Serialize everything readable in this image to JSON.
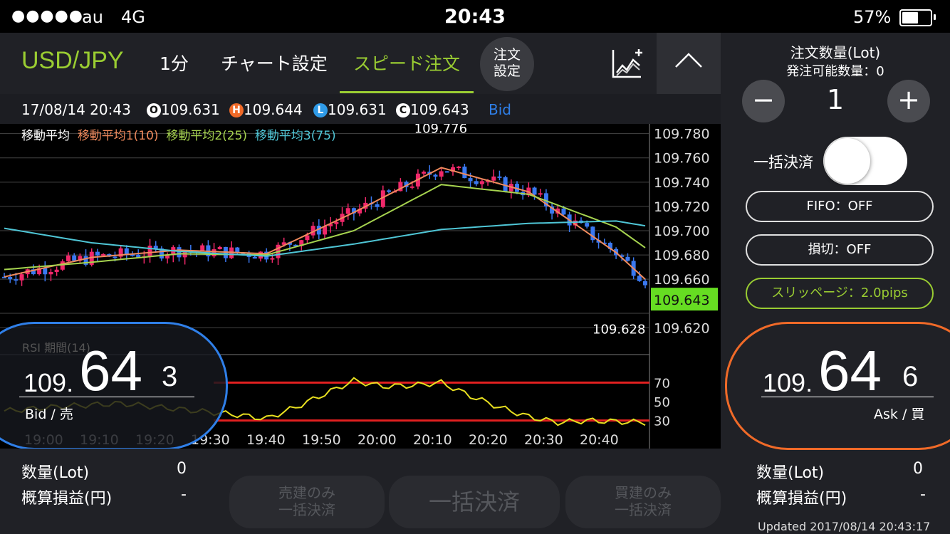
{
  "status_bar": {
    "signal": "●●●●●",
    "carrier": "au",
    "network": "4G",
    "time": "20:43",
    "battery": "57%"
  },
  "header": {
    "pair": "USD/JPY",
    "interval": "1分",
    "chart_settings": "チャート設定",
    "speed_order": "スピード注文",
    "order_settings_line1": "注文",
    "order_settings_line2": "設定",
    "icons": [
      "chart-add-icon",
      "chevron-up-icon"
    ]
  },
  "info_row": {
    "datetime": "17/08/14 20:43",
    "open_badge": "O",
    "open": "109.631",
    "high_badge": "H",
    "high": "109.644",
    "low_badge": "L",
    "low": "109.631",
    "close_badge": "C",
    "close": "109.643",
    "price_type": "Bid"
  },
  "legend": {
    "ma_label": "移動平均",
    "ma1": "移動平均1(10)",
    "ma2": "移動平均2(25)",
    "ma3": "移動平均3(75)"
  },
  "colors": {
    "accent_green": "#9acd32",
    "ma1": "#f08a5d",
    "ma2": "#a6d34f",
    "ma3": "#4fc6d6",
    "bull": "#f0286a",
    "bear": "#3a78f0",
    "bid_ring": "#2f7fe8",
    "ask_ring": "#f06a28"
  },
  "chart_data": [
    {
      "type": "line",
      "title": "",
      "y_ticks": [
        "109.780",
        "109.760",
        "109.740",
        "109.720",
        "109.700",
        "109.680",
        "109.660",
        "109.620"
      ],
      "ylim": [
        109.612,
        109.788
      ],
      "x_ticks": [
        "19:00",
        "19:10",
        "19:20",
        "19:30",
        "19:40",
        "19:50",
        "20:00",
        "20:10",
        "20:20",
        "20:30",
        "20:40"
      ],
      "high_label": "109.776",
      "low_label": "109.628",
      "current_price": "109.643",
      "candles_note": "1-minute candlesticks",
      "series": [
        {
          "name": "移動平均1(10)",
          "x": [
            0,
            15,
            30,
            45,
            60,
            75,
            90,
            105,
            110
          ],
          "y": [
            109.662,
            109.678,
            109.684,
            109.681,
            109.715,
            109.752,
            109.732,
            109.682,
            109.66
          ]
        },
        {
          "name": "移動平均2(25)",
          "x": [
            0,
            15,
            30,
            45,
            60,
            75,
            90,
            105,
            110
          ],
          "y": [
            109.668,
            109.674,
            109.681,
            109.68,
            109.7,
            109.738,
            109.73,
            109.703,
            109.686
          ]
        },
        {
          "name": "移動平均3(75)",
          "x": [
            0,
            15,
            30,
            45,
            60,
            75,
            90,
            105,
            110
          ],
          "y": [
            109.702,
            109.69,
            109.683,
            109.679,
            109.689,
            109.701,
            109.706,
            109.708,
            109.704
          ]
        }
      ]
    },
    {
      "type": "line",
      "title": "RSI",
      "label": "RSI 期間(14)",
      "y_ticks": [
        "70",
        "50",
        "30"
      ],
      "ylim": [
        20,
        80
      ],
      "series": [
        {
          "name": "RSI",
          "x": [
            0,
            10,
            20,
            30,
            40,
            45,
            50,
            55,
            60,
            65,
            70,
            75,
            80,
            85,
            90,
            95,
            100,
            105,
            110
          ],
          "y": [
            40,
            45,
            48,
            42,
            36,
            32,
            44,
            58,
            72,
            66,
            67,
            70,
            56,
            44,
            34,
            28,
            30,
            29,
            28
          ]
        }
      ]
    }
  ],
  "bid": {
    "prefix": "109.",
    "big": "64",
    "last": "3",
    "label": "Bid / 売"
  },
  "ask": {
    "prefix": "109.",
    "big": "64",
    "last": "6",
    "label": "Ask / 買"
  },
  "bottom": {
    "qty_label": "数量(Lot)",
    "qty_value": "0",
    "pl_label": "概算損益(円)",
    "pl_value": "-",
    "sell_only_line1": "売建のみ",
    "sell_only_line2": "一括決済",
    "settle_all": "一括決済",
    "buy_only_line1": "買建のみ",
    "buy_only_line2": "一括決済",
    "right_qty_label": "数量(Lot)",
    "right_qty_value": "0",
    "right_pl_label": "概算損益(円)",
    "right_pl_value": "-",
    "updated": "Updated 2017/08/14 20:43:17"
  },
  "right_panel": {
    "order_qty_title": "注文数量(Lot)",
    "available_qty": "発注可能数量：0",
    "qty_value": "1",
    "minus": "−",
    "plus": "+",
    "settle_all_label": "一括決済",
    "fifo": "FIFO：OFF",
    "stop_loss": "損切：OFF",
    "slippage": "スリッページ：2.0pips"
  }
}
